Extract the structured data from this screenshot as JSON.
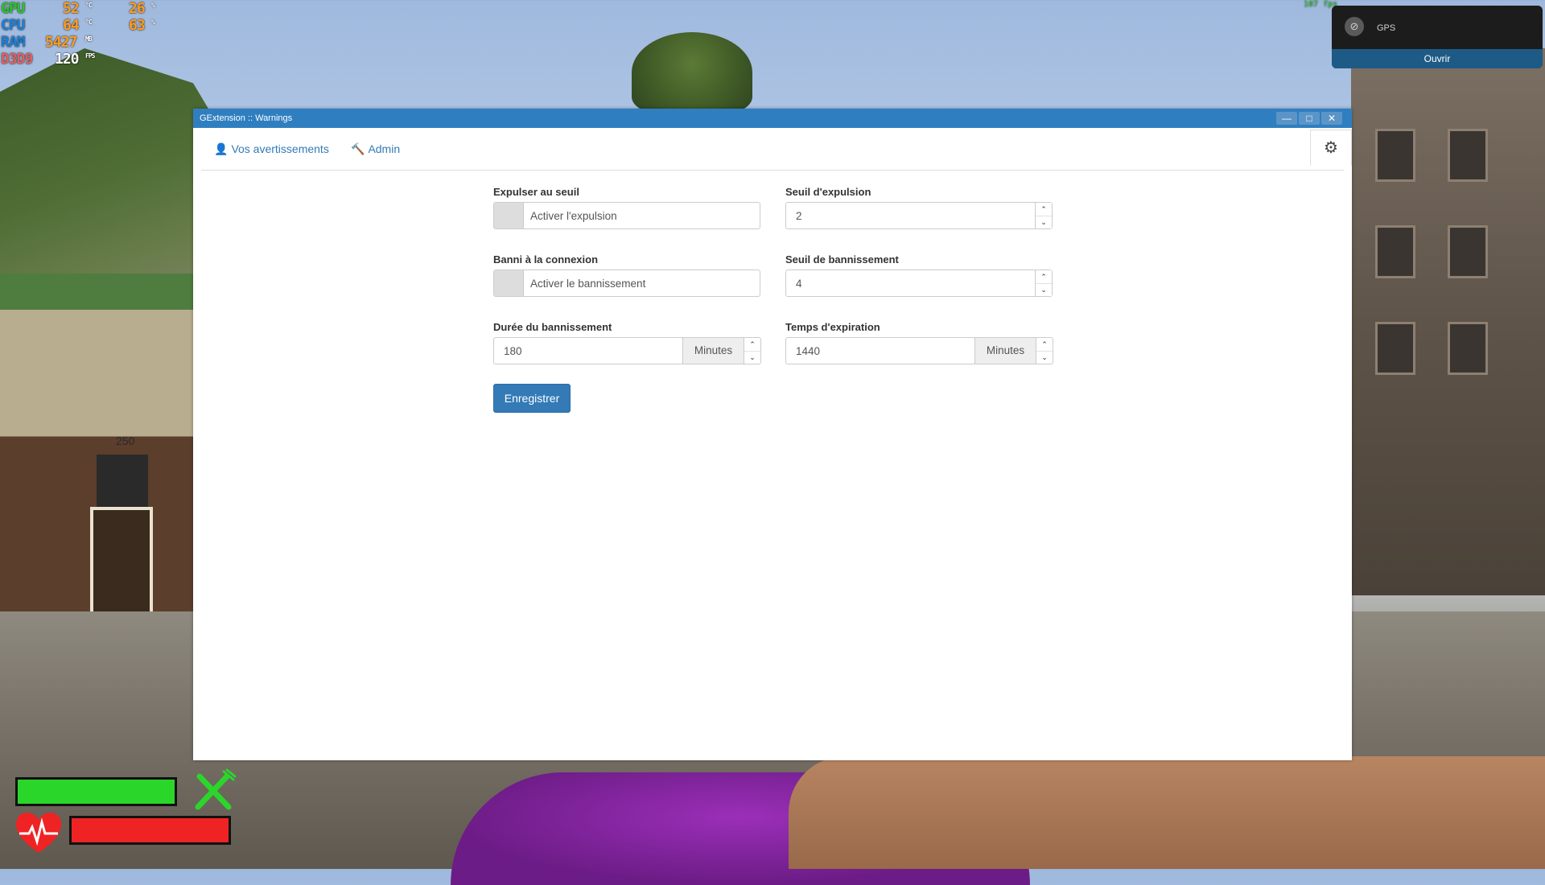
{
  "hud": {
    "gpu_label": "GPU",
    "gpu_temp": "52",
    "gpu_temp_unit": "°C",
    "gpu_load": "26",
    "gpu_load_unit": "%",
    "cpu_label": "CPU",
    "cpu_temp": "64",
    "cpu_temp_unit": "°C",
    "cpu_load": "63",
    "cpu_load_unit": "%",
    "ram_label": "RAM",
    "ram_value": "5427",
    "ram_unit": "MB",
    "api_label": "D3D9",
    "fps_value": "120",
    "fps_unit": "FPS",
    "fps_top": "107 fps"
  },
  "notification": {
    "title": "GPS",
    "button_label": "Ouvrir",
    "icon": "compass-icon"
  },
  "window": {
    "title": "GExtension :: Warnings",
    "controls": {
      "minimize": "—",
      "maximize": "□",
      "close": "✕"
    }
  },
  "nav": {
    "tabs": [
      {
        "label": "Vos avertissements",
        "icon": "user-icon"
      },
      {
        "label": "Admin",
        "icon": "gavel-icon"
      }
    ],
    "settings_icon": "gears-icon"
  },
  "form": {
    "kick_threshold_toggle": {
      "label": "Expulser au seuil",
      "text": "Activer l'expulsion"
    },
    "kick_threshold": {
      "label": "Seuil d'expulsion",
      "value": "2"
    },
    "ban_on_connect_toggle": {
      "label": "Banni à la connexion",
      "text": "Activer le bannissement"
    },
    "ban_threshold": {
      "label": "Seuil de bannissement",
      "value": "4"
    },
    "ban_duration": {
      "label": "Durée du bannissement",
      "value": "180",
      "unit": "Minutes"
    },
    "expiration_time": {
      "label": "Temps d'expiration",
      "value": "1440",
      "unit": "Minutes"
    },
    "save_label": "Enregistrer"
  },
  "colors": {
    "accent": "#337ab7",
    "titlebar": "#2f7fc0",
    "health_bar": "#2bd62b",
    "hunger_bar": "#ef2323"
  }
}
